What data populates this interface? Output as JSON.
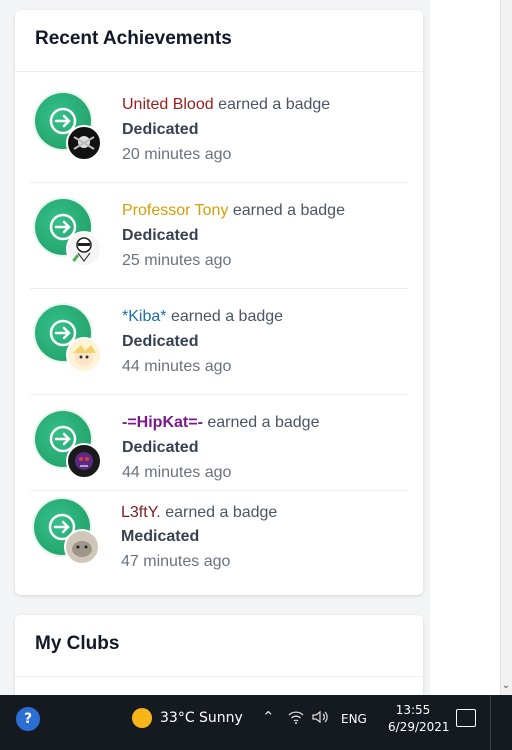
{
  "achievements": {
    "title": "Recent Achievements",
    "items": [
      {
        "user": "United Blood",
        "user_color": "#9b1c1c",
        "action": "earned a badge",
        "badge": "Dedicated",
        "time": "20 minutes ago"
      },
      {
        "user": "Professor Tony",
        "user_color": "#d69e06",
        "action": "earned a badge",
        "badge": "Dedicated",
        "time": "25 minutes ago"
      },
      {
        "user": "*Kiba*",
        "user_color": "#1d6fa5",
        "action": "earned a badge",
        "badge": "Dedicated",
        "time": "44 minutes ago"
      },
      {
        "user": "-=HipKat=-",
        "user_color": "#7c1a8c",
        "action": "earned a badge",
        "badge": "Dedicated",
        "time": "44 minutes ago"
      },
      {
        "user": "L3ftY.",
        "user_color": "#7a1f1f",
        "action": "earned a badge",
        "badge": "Medicated",
        "time": "47 minutes ago"
      }
    ]
  },
  "clubs": {
    "title": "My Clubs"
  },
  "taskbar": {
    "help_icon": "?",
    "weather": "33°C  Sunny",
    "lang": "ENG",
    "time": "13:55",
    "date": "6/29/2021"
  },
  "colors": {
    "badge": "#22a06b",
    "taskbar": "#151a21"
  }
}
